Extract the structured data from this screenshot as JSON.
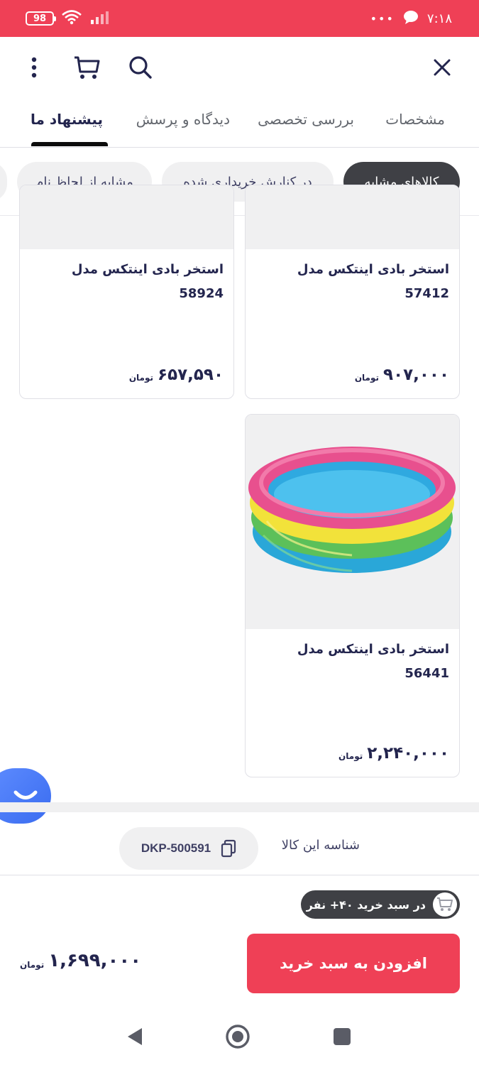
{
  "status_bar": {
    "time": "۷:۱۸",
    "battery": "98",
    "dots": "•••"
  },
  "app_bar": {
    "icons": [
      "close-icon",
      "search-icon",
      "cart-icon",
      "more-vertical-icon"
    ]
  },
  "tabs": [
    {
      "label": "مشخصات",
      "active": false
    },
    {
      "label": "بررسی تخصصی",
      "active": false
    },
    {
      "label": "دیدگاه و پرسش",
      "active": false
    },
    {
      "label": "پیشنهاد ما",
      "active": true
    }
  ],
  "chips": [
    {
      "label": "کالاهای مشابه",
      "active": true
    },
    {
      "label": "در کنارش خریداری شده",
      "active": false
    },
    {
      "label": "مشابه از لحاظ نام",
      "active": false
    }
  ],
  "products": [
    {
      "title_line1": "استخر بادی اینتکس مدل",
      "title_line2": "57412",
      "price": "۹۰۷,۰۰۰",
      "currency": "تومان"
    },
    {
      "title_line1": "استخر بادی اینتکس مدل",
      "title_line2": "58924",
      "price": "۶۵۷,۵۹۰",
      "currency": "تومان"
    },
    {
      "title_line1": "استخر بادی اینتکس مدل",
      "title_line2": "56441",
      "price": "۲,۲۴۰,۰۰۰",
      "currency": "تومان"
    }
  ],
  "product_id": {
    "label": "شناسه این کالا",
    "value": "DKP-500591"
  },
  "cart_badge": {
    "text": "در سبد خرید ۴۰+ نفر"
  },
  "buy_bar": {
    "add_to_cart_label": "افزودن به سبد خرید",
    "price": "۱,۶۹۹,۰۰۰",
    "currency": "تومان"
  },
  "colors": {
    "brand_red": "#ef4056",
    "dark": "#3f4045",
    "text": "#23254e",
    "chat_blue": "#3a6cf0"
  }
}
